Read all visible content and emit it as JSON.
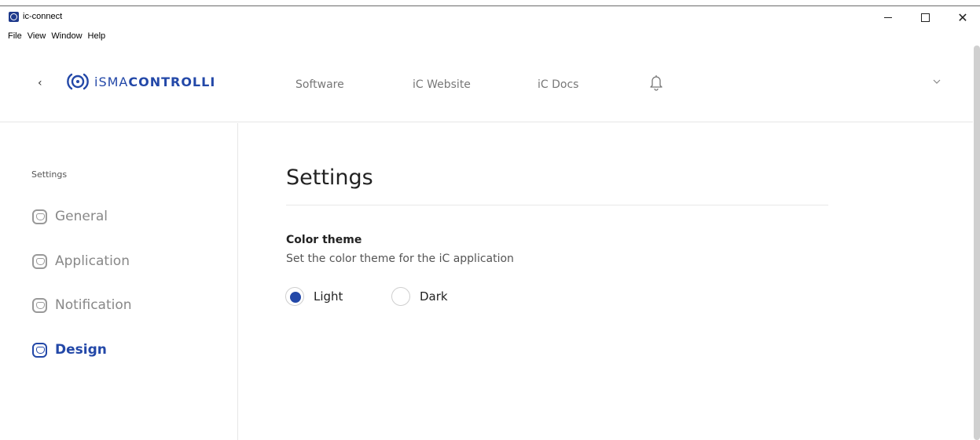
{
  "window": {
    "title": "ic-connect",
    "controls": {
      "minimize": "minimize-icon",
      "maximize": "maximize-icon",
      "close": "✕"
    }
  },
  "menu": [
    "File",
    "View",
    "Window",
    "Help"
  ],
  "header": {
    "back_icon": "‹",
    "logo": {
      "prefix": "iSMA",
      "bold": "CONTROLLI"
    },
    "nav": [
      "Software",
      "iC Website",
      "iC Docs"
    ],
    "bell_icon": "bell-icon",
    "dropdown_icon": "chevron-down-icon"
  },
  "sidebar": {
    "heading": "Settings",
    "items": [
      {
        "label": "General",
        "active": false
      },
      {
        "label": "Application",
        "active": false
      },
      {
        "label": "Notification",
        "active": false
      },
      {
        "label": "Design",
        "active": true
      }
    ]
  },
  "main": {
    "title": "Settings",
    "section": {
      "title": "Color theme",
      "description": "Set the color theme for the iC application",
      "options": [
        {
          "label": "Light",
          "selected": true
        },
        {
          "label": "Dark",
          "selected": false
        }
      ]
    }
  },
  "colors": {
    "accent": "#2348a8",
    "muted_text": "#888888",
    "border": "#e6e6e6"
  }
}
